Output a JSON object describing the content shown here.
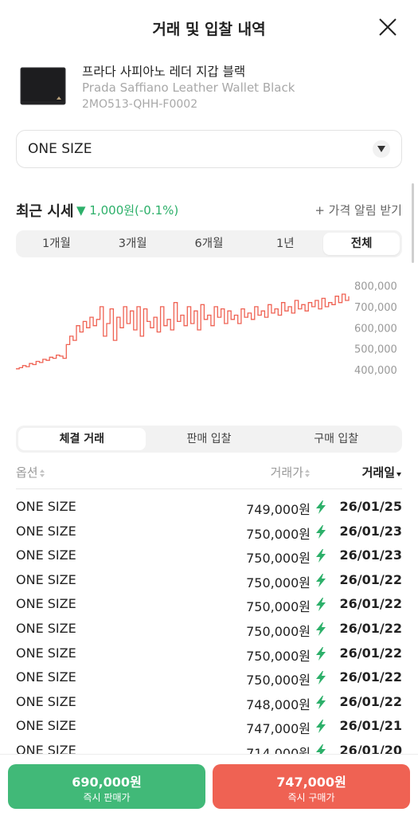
{
  "header": {
    "title": "거래 및 입찰 내역"
  },
  "product": {
    "name_ko": "프라다 사피아노 레더 지갑 블랙",
    "name_en": "Prada Saffiano Leather Wallet Black",
    "code": "2MO513-QHH-F0002"
  },
  "size_select": {
    "value": "ONE SIZE"
  },
  "recent": {
    "title": "최근 시세",
    "change": "▼ 1,000원(-0.1%)",
    "alert_label": "+ 가격 알림 받기"
  },
  "period_tabs": [
    "1개월",
    "3개월",
    "6개월",
    "1년",
    "전체"
  ],
  "active_period": "전체",
  "chart_data": {
    "type": "line",
    "color": "#ef6253",
    "y_ticks": [
      800000,
      700000,
      600000,
      500000,
      400000
    ],
    "y_tick_labels": [
      "800,000",
      "700,000",
      "600,000",
      "500,000",
      "400,000"
    ],
    "ylim": [
      370000,
      840000
    ],
    "series": [
      {
        "values": [
          405000,
          410000,
          420000,
          415000,
          430000,
          425000,
          440000,
          435000,
          450000,
          445000,
          460000,
          455000,
          470000,
          465000,
          455000,
          520000,
          560000,
          540000,
          610000,
          580000,
          630000,
          600000,
          650000,
          610000,
          640000,
          700000,
          560000,
          620000,
          690000,
          540000,
          650000,
          600000,
          700000,
          620000,
          680000,
          590000,
          700000,
          560000,
          690000,
          630000,
          600000,
          650000,
          580000,
          700000,
          610000,
          640000,
          590000,
          720000,
          630000,
          660000,
          610000,
          700000,
          620000,
          680000,
          590000,
          710000,
          640000,
          660000,
          610000,
          700000,
          650000,
          690000,
          620000,
          680000,
          640000,
          660000,
          620000,
          690000,
          650000,
          670000,
          640000,
          700000,
          660000,
          680000,
          650000,
          710000,
          670000,
          690000,
          660000,
          720000,
          680000,
          700000,
          670000,
          730000,
          690000,
          710000,
          680000,
          720000,
          700000,
          730000,
          690000,
          740000,
          700000,
          720000,
          710000,
          750000,
          720000,
          760000,
          730000,
          750000
        ]
      }
    ]
  },
  "trade_tabs": [
    "체결 거래",
    "판매 입찰",
    "구매 입찰"
  ],
  "active_trade_tab": "체결 거래",
  "table": {
    "headers": {
      "option": "옵션",
      "price": "거래가",
      "date": "거래일"
    },
    "rows": [
      {
        "option": "ONE SIZE",
        "price": "749,000원",
        "date": "26/01/25"
      },
      {
        "option": "ONE SIZE",
        "price": "750,000원",
        "date": "26/01/23"
      },
      {
        "option": "ONE SIZE",
        "price": "750,000원",
        "date": "26/01/23"
      },
      {
        "option": "ONE SIZE",
        "price": "750,000원",
        "date": "26/01/22"
      },
      {
        "option": "ONE SIZE",
        "price": "750,000원",
        "date": "26/01/22"
      },
      {
        "option": "ONE SIZE",
        "price": "750,000원",
        "date": "26/01/22"
      },
      {
        "option": "ONE SIZE",
        "price": "750,000원",
        "date": "26/01/22"
      },
      {
        "option": "ONE SIZE",
        "price": "750,000원",
        "date": "26/01/22"
      },
      {
        "option": "ONE SIZE",
        "price": "748,000원",
        "date": "26/01/22"
      },
      {
        "option": "ONE SIZE",
        "price": "747,000원",
        "date": "26/01/21"
      },
      {
        "option": "ONE SIZE",
        "price": "714,000원",
        "date": "26/01/20"
      }
    ]
  },
  "bottom": {
    "sell_price": "690,000원",
    "sell_label": "즉시 판매가",
    "buy_price": "747,000원",
    "buy_label": "즉시 구매가"
  },
  "colors": {
    "green": "#41b978",
    "red": "#ef6253"
  }
}
